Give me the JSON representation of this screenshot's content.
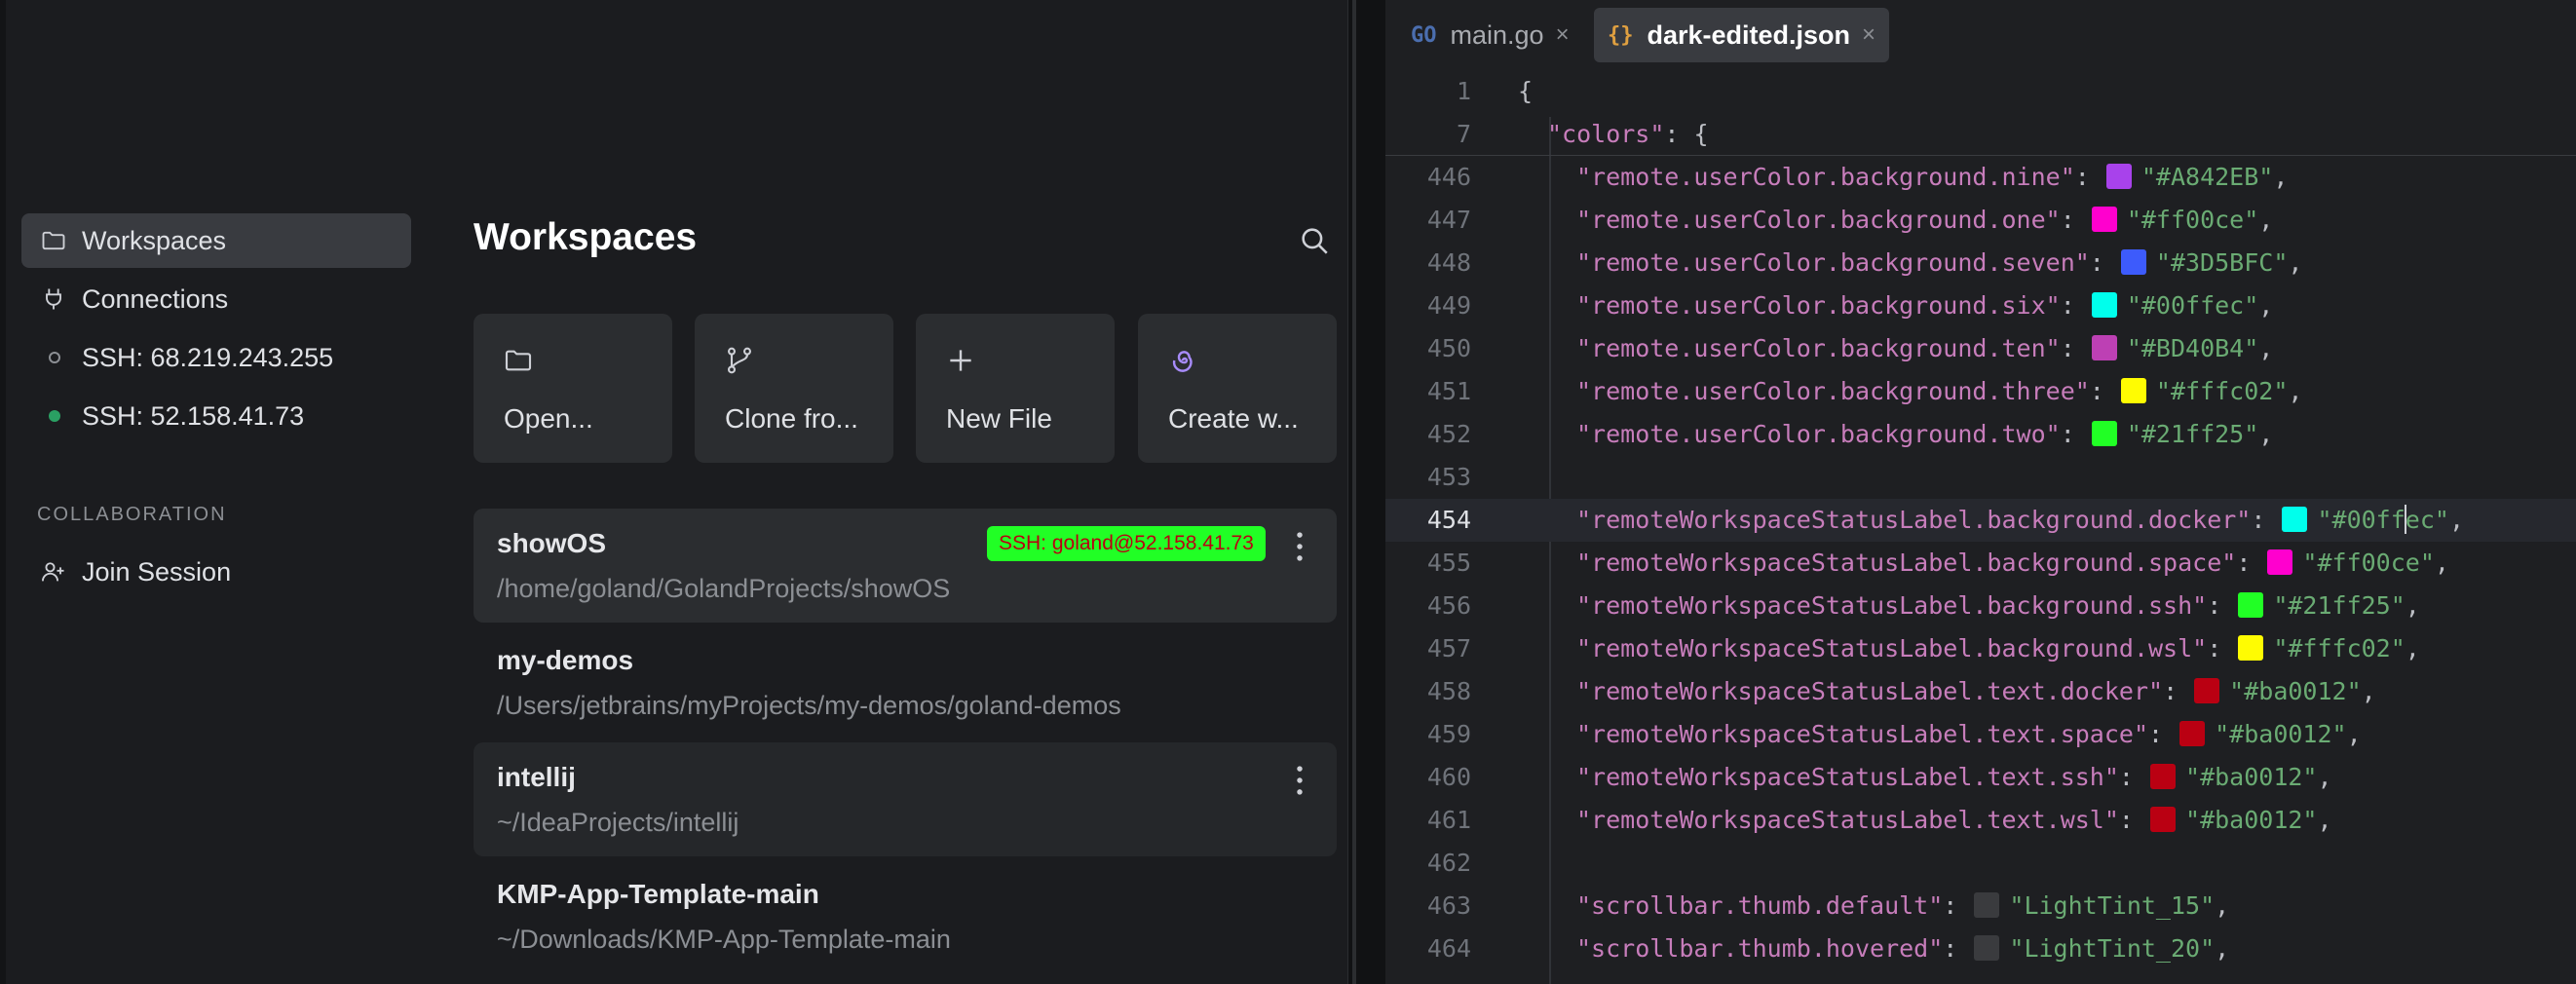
{
  "sidebar": {
    "items": [
      {
        "label": "Workspaces"
      },
      {
        "label": "Connections"
      },
      {
        "label": "SSH: 68.219.243.255"
      },
      {
        "label": "SSH: 52.158.41.73"
      }
    ],
    "section_label": "COLLABORATION",
    "join_label": "Join Session"
  },
  "workspaces": {
    "title": "Workspaces",
    "actions": [
      {
        "label": "Open...",
        "icon": "folder-icon"
      },
      {
        "label": "Clone fro...",
        "icon": "git-branch-icon"
      },
      {
        "label": "New File",
        "icon": "plus-icon"
      },
      {
        "label": "Create w...",
        "icon": "swirl-icon"
      }
    ],
    "projects": [
      {
        "name": "showOS",
        "path": "/home/goland/GolandProjects/showOS",
        "badge": "SSH: goland@52.158.41.73"
      },
      {
        "name": "my-demos",
        "path": "/Users/jetbrains/myProjects/my-demos/goland-demos"
      },
      {
        "name": "intellij",
        "path": "~/IdeaProjects/intellij"
      },
      {
        "name": "KMP-App-Template-main",
        "path": "~/Downloads/KMP-App-Template-main"
      }
    ]
  },
  "editor": {
    "tabs": [
      {
        "icon_text": "GO",
        "label": "main.go"
      },
      {
        "icon_text": "{}",
        "label": "dark-edited.json"
      }
    ],
    "sticky": [
      {
        "n": "1",
        "text": "{"
      },
      {
        "n": "7",
        "key": "\"colors\"",
        "rest": ": {"
      }
    ],
    "lines": [
      {
        "n": "446",
        "key": "\"remote.userColor.background.nine\"",
        "color": "#A842EB",
        "value": "\"#A842EB\""
      },
      {
        "n": "447",
        "key": "\"remote.userColor.background.one\"",
        "color": "#ff00ce",
        "value": "\"#ff00ce\""
      },
      {
        "n": "448",
        "key": "\"remote.userColor.background.seven\"",
        "color": "#3D5BFC",
        "value": "\"#3D5BFC\""
      },
      {
        "n": "449",
        "key": "\"remote.userColor.background.six\"",
        "color": "#00ffec",
        "value": "\"#00ffec\""
      },
      {
        "n": "450",
        "key": "\"remote.userColor.background.ten\"",
        "color": "#BD40B4",
        "value": "\"#BD40B4\""
      },
      {
        "n": "451",
        "key": "\"remote.userColor.background.three\"",
        "color": "#fffc02",
        "value": "\"#fffc02\""
      },
      {
        "n": "452",
        "key": "\"remote.userColor.background.two\"",
        "color": "#21ff25",
        "value": "\"#21ff25\""
      },
      {
        "n": "453"
      },
      {
        "n": "454",
        "key": "\"remoteWorkspaceStatusLabel.background.docker\"",
        "color": "#00ffec",
        "value_a": "\"#00ff",
        "value_b": "ec\"",
        "highlight": true
      },
      {
        "n": "455",
        "key": "\"remoteWorkspaceStatusLabel.background.space\"",
        "color": "#ff00ce",
        "value": "\"#ff00ce\""
      },
      {
        "n": "456",
        "key": "\"remoteWorkspaceStatusLabel.background.ssh\"",
        "color": "#21ff25",
        "value": "\"#21ff25\""
      },
      {
        "n": "457",
        "key": "\"remoteWorkspaceStatusLabel.background.wsl\"",
        "color": "#fffc02",
        "value": "\"#fffc02\""
      },
      {
        "n": "458",
        "key": "\"remoteWorkspaceStatusLabel.text.docker\"",
        "color": "#ba0012",
        "value": "\"#ba0012\""
      },
      {
        "n": "459",
        "key": "\"remoteWorkspaceStatusLabel.text.space\"",
        "color": "#ba0012",
        "value": "\"#ba0012\""
      },
      {
        "n": "460",
        "key": "\"remoteWorkspaceStatusLabel.text.ssh\"",
        "color": "#ba0012",
        "value": "\"#ba0012\""
      },
      {
        "n": "461",
        "key": "\"remoteWorkspaceStatusLabel.text.wsl\"",
        "color": "#ba0012",
        "value": "\"#ba0012\""
      },
      {
        "n": "462"
      },
      {
        "n": "463",
        "key": "\"scrollbar.thumb.default\"",
        "color": "#3a3b3e",
        "value": "\"LightTint_15\""
      },
      {
        "n": "464",
        "key": "\"scrollbar.thumb.hovered\"",
        "color": "#3a3b3e",
        "value": "\"LightTint_20\""
      }
    ]
  },
  "colors": {
    "badge_bg": "#21ff25",
    "badge_text": "#ba0012",
    "key": "#c77dbb",
    "string": "#6aab73"
  }
}
